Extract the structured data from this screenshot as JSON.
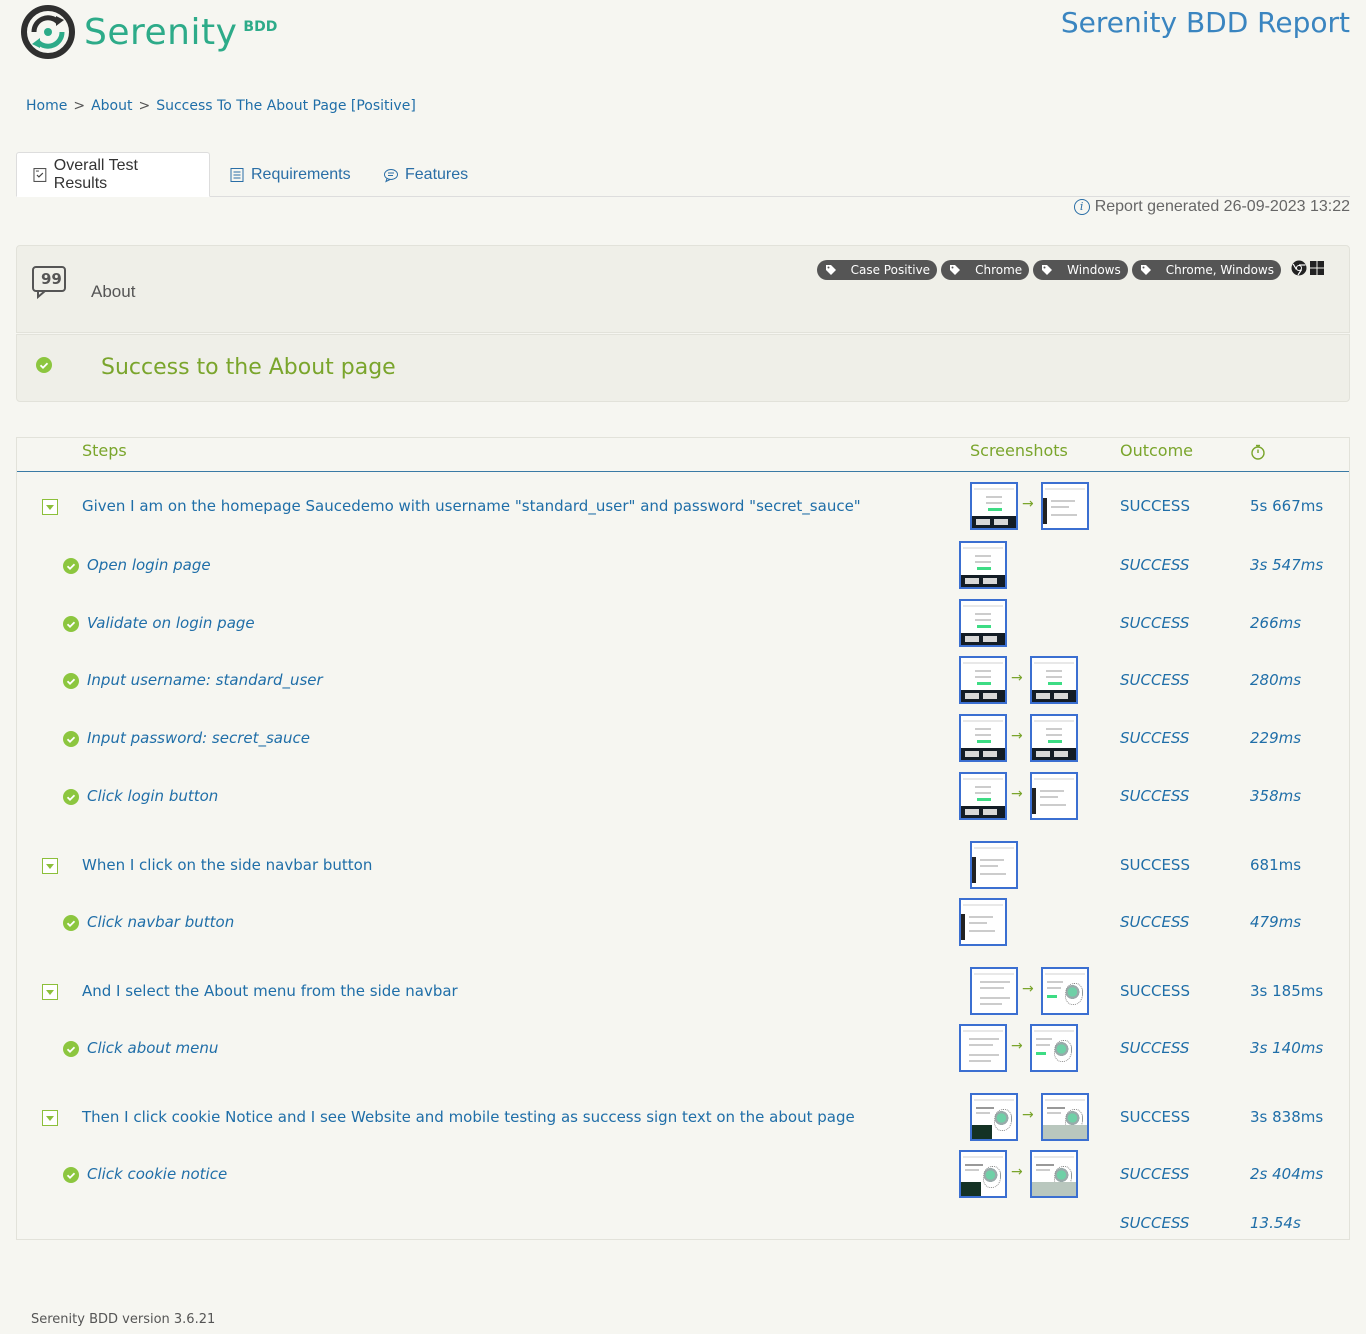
{
  "brand": {
    "name": "Serenity",
    "suffix": "BDD",
    "color": "#2dab89"
  },
  "report_title": "Serenity BDD Report",
  "breadcrumb": {
    "home": "Home",
    "about": "About",
    "current": "Success To The About Page [Positive]",
    "separator": ">"
  },
  "tabs": [
    {
      "label": "Overall Test Results",
      "icon": "checklist-icon",
      "active": true
    },
    {
      "label": "Requirements",
      "icon": "list-icon",
      "active": false
    },
    {
      "label": "Features",
      "icon": "comment-icon",
      "active": false
    }
  ],
  "generated": "Report generated 26-09-2023 13:22",
  "feature": {
    "name": "About",
    "tags": [
      "Case Positive",
      "Chrome",
      "Windows",
      "Chrome, Windows"
    ]
  },
  "scenario": {
    "title": "Success to the About page"
  },
  "table": {
    "headers": {
      "steps": "Steps",
      "screenshots": "Screenshots",
      "outcome": "Outcome",
      "duration_icon": "stopwatch-icon"
    },
    "rows": [
      {
        "kind": "group",
        "text": "Given I am on the homepage Saucedemo with username \"standard_user\" and password \"secret_sauce\"",
        "outcome": "SUCCESS",
        "duration": "5s 667ms",
        "shots": [
          "login",
          "inventory"
        ]
      },
      {
        "kind": "sub",
        "text": "Open login page",
        "outcome": "SUCCESS",
        "duration": "3s 547ms",
        "shots": [
          "login"
        ]
      },
      {
        "kind": "sub",
        "text": "Validate on login page",
        "outcome": "SUCCESS",
        "duration": "266ms",
        "shots": [
          "login"
        ]
      },
      {
        "kind": "sub",
        "text": "Input username: standard_user",
        "outcome": "SUCCESS",
        "duration": "280ms",
        "shots": [
          "login",
          "login"
        ]
      },
      {
        "kind": "sub",
        "text": "Input password: secret_sauce",
        "outcome": "SUCCESS",
        "duration": "229ms",
        "shots": [
          "login",
          "login"
        ]
      },
      {
        "kind": "sub",
        "text": "Click login button",
        "outcome": "SUCCESS",
        "duration": "358ms",
        "shots": [
          "login",
          "inventory"
        ]
      },
      {
        "kind": "group",
        "text": "When I click on the side navbar button",
        "outcome": "SUCCESS",
        "duration": "681ms",
        "shots": [
          "inventory"
        ]
      },
      {
        "kind": "sub",
        "text": "Click navbar button",
        "outcome": "SUCCESS",
        "duration": "479ms",
        "shots": [
          "inventory"
        ]
      },
      {
        "kind": "group",
        "text": "And I select the About menu from the side navbar",
        "outcome": "SUCCESS",
        "duration": "3s 185ms",
        "shots": [
          "text",
          "about"
        ]
      },
      {
        "kind": "sub",
        "text": "Click about menu",
        "outcome": "SUCCESS",
        "duration": "3s 140ms",
        "shots": [
          "text",
          "about"
        ]
      },
      {
        "kind": "group",
        "text": "Then I click cookie Notice and I see Website and mobile testing as success sign text on the about page",
        "outcome": "SUCCESS",
        "duration": "3s 838ms",
        "shots": [
          "cookie",
          "cookie2"
        ]
      },
      {
        "kind": "sub",
        "text": "Click cookie notice",
        "outcome": "SUCCESS",
        "duration": "2s 404ms",
        "shots": [
          "cookie",
          "cookie2"
        ]
      }
    ],
    "total": {
      "outcome": "SUCCESS",
      "duration": "13.54s"
    }
  },
  "footer": "Serenity BDD version 3.6.21",
  "colors": {
    "link": "#1f6ea8",
    "success": "#7aa52c",
    "title": "#3a85c0",
    "screenshot_border": "#3b6fd1"
  }
}
